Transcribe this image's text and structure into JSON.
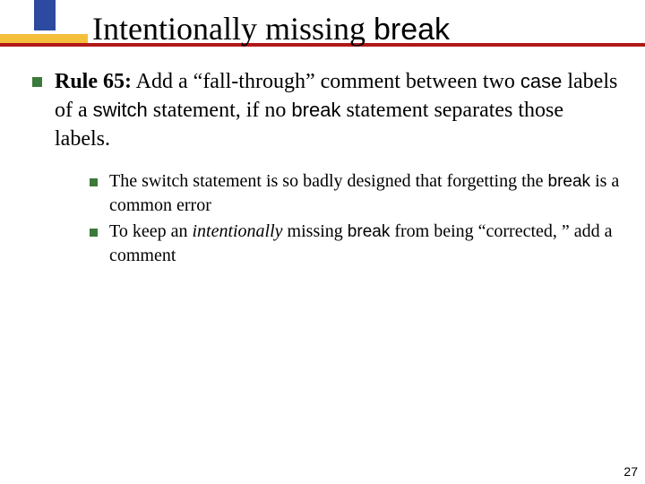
{
  "title": {
    "prefix": "Intentionally missing ",
    "code": "break"
  },
  "main": {
    "rule_strong": "Rule 65:",
    "seg1": " Add a “fall-through” comment between two ",
    "code_case": "case",
    "seg2": " labels of a ",
    "code_switch": "switch",
    "seg3": " statement, if no ",
    "code_break": "break",
    "seg4": " statement separates those labels."
  },
  "sub": [
    {
      "seg1": "The switch statement is so badly designed that forgetting the ",
      "code": "break",
      "seg2": " is a common error"
    },
    {
      "seg1": "To keep an ",
      "em": "intentionally",
      "seg2": " missing ",
      "code": "break",
      "seg3": " from being “corrected, ” add a comment"
    }
  ],
  "page_number": "27"
}
